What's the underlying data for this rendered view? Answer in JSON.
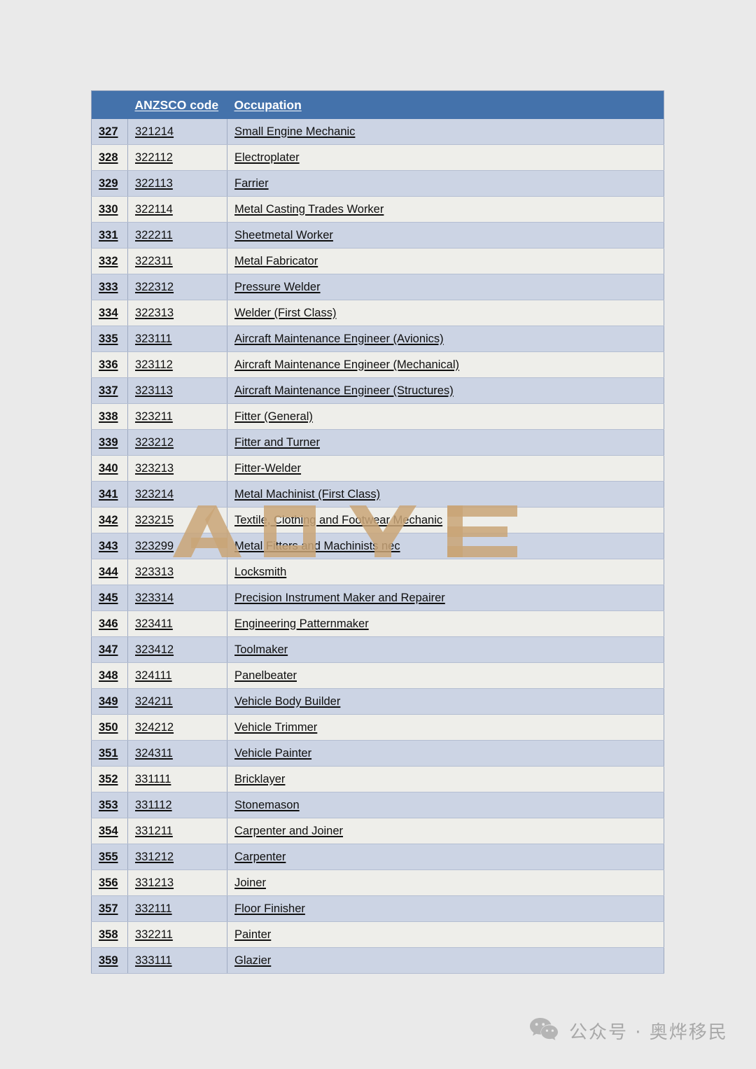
{
  "page": {
    "background_color": "#eaeaea"
  },
  "table": {
    "header_bg_color": "#4472ab",
    "row_color_odd": "#ccd4e4",
    "row_color_even": "#eeeeea",
    "columns": [
      "",
      "ANZSCO code",
      "Occupation"
    ],
    "rows": [
      {
        "index": "327",
        "code": "321214",
        "occupation": "Small Engine Mechanic"
      },
      {
        "index": "328",
        "code": "322112",
        "occupation": "Electroplater"
      },
      {
        "index": "329",
        "code": "322113",
        "occupation": "Farrier"
      },
      {
        "index": "330",
        "code": "322114",
        "occupation": "Metal Casting Trades Worker"
      },
      {
        "index": "331",
        "code": "322211",
        "occupation": "Sheetmetal Worker"
      },
      {
        "index": "332",
        "code": "322311",
        "occupation": "Metal Fabricator"
      },
      {
        "index": "333",
        "code": "322312",
        "occupation": "Pressure Welder"
      },
      {
        "index": "334",
        "code": "322313",
        "occupation": "Welder (First Class)"
      },
      {
        "index": "335",
        "code": "323111",
        "occupation": "Aircraft Maintenance Engineer (Avionics)"
      },
      {
        "index": "336",
        "code": "323112",
        "occupation": "Aircraft Maintenance Engineer (Mechanical)"
      },
      {
        "index": "337",
        "code": "323113",
        "occupation": "Aircraft Maintenance Engineer (Structures)"
      },
      {
        "index": "338",
        "code": "323211",
        "occupation": "Fitter (General)"
      },
      {
        "index": "339",
        "code": "323212",
        "occupation": "Fitter and Turner"
      },
      {
        "index": "340",
        "code": "323213",
        "occupation": "Fitter-Welder"
      },
      {
        "index": "341",
        "code": "323214",
        "occupation": "Metal Machinist (First Class)"
      },
      {
        "index": "342",
        "code": "323215",
        "occupation": "Textile, Clothing and Footwear Mechanic"
      },
      {
        "index": "343",
        "code": "323299",
        "occupation": "Metal Fitters and Machinists nec"
      },
      {
        "index": "344",
        "code": "323313",
        "occupation": "Locksmith"
      },
      {
        "index": "345",
        "code": "323314",
        "occupation": "Precision Instrument Maker and Repairer"
      },
      {
        "index": "346",
        "code": "323411",
        "occupation": "Engineering Patternmaker"
      },
      {
        "index": "347",
        "code": "323412",
        "occupation": "Toolmaker"
      },
      {
        "index": "348",
        "code": "324111",
        "occupation": "Panelbeater"
      },
      {
        "index": "349",
        "code": "324211",
        "occupation": "Vehicle Body Builder"
      },
      {
        "index": "350",
        "code": "324212",
        "occupation": "Vehicle Trimmer"
      },
      {
        "index": "351",
        "code": "324311",
        "occupation": "Vehicle Painter"
      },
      {
        "index": "352",
        "code": "331111",
        "occupation": "Bricklayer"
      },
      {
        "index": "353",
        "code": "331112",
        "occupation": "Stonemason"
      },
      {
        "index": "354",
        "code": "331211",
        "occupation": "Carpenter and Joiner"
      },
      {
        "index": "355",
        "code": "331212",
        "occupation": "Carpenter"
      },
      {
        "index": "356",
        "code": "331213",
        "occupation": "Joiner"
      },
      {
        "index": "357",
        "code": "332111",
        "occupation": "Floor Finisher"
      },
      {
        "index": "358",
        "code": "332211",
        "occupation": "Painter"
      },
      {
        "index": "359",
        "code": "333111",
        "occupation": "Glazier"
      }
    ]
  },
  "watermark": {
    "text": "AOYE",
    "color": "#c9a577"
  },
  "footer": {
    "icon": "wechat-icon",
    "text": "公众号 · 奥烨移民",
    "color": "#a8a8a8"
  }
}
